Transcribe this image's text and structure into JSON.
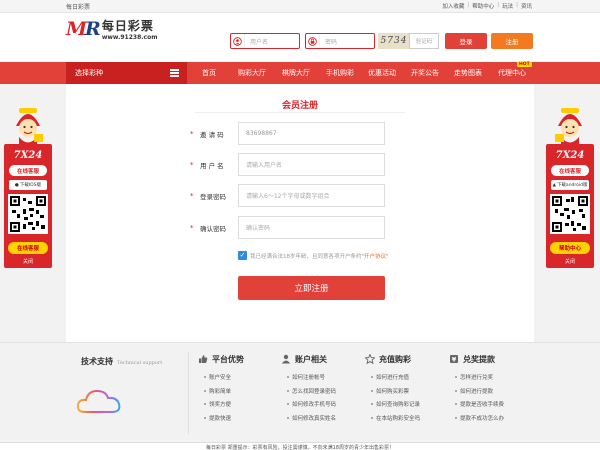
{
  "topbar": {
    "site_name": "每日彩票",
    "links": [
      "加入收藏",
      "帮助中心",
      "玩法",
      "资讯"
    ],
    "separator": "|"
  },
  "header": {
    "logo_mark_left": "M",
    "logo_mark_right": "R",
    "logo_name": "每日彩票",
    "logo_url": "www.91238.com",
    "username_placeholder": "用户名",
    "password_placeholder": "密码",
    "captcha_image_text": "5734",
    "captcha_placeholder": "验证码",
    "login_label": "登录",
    "register_label": "注册"
  },
  "nav": {
    "select_label": "选择彩种",
    "items": [
      "首页",
      "购彩大厅",
      "棋牌大厅",
      "手机购彩",
      "优惠活动",
      "开奖公告",
      "走势图表",
      "代理中心"
    ],
    "hot_tag": "HOT"
  },
  "form": {
    "title": "会员注册",
    "required_mark": "*",
    "rows": [
      {
        "label": "邀 请 码",
        "value": "83698867"
      },
      {
        "label": "用 户 名",
        "value": "请输入用户名"
      },
      {
        "label": "登录密码",
        "value": "请输入6～12个字母或数字组合"
      },
      {
        "label": "确认密码",
        "value": "确认密码"
      }
    ],
    "agree_text": "我已经满合法18岁年龄，且同意各项开户条约",
    "agree_protocol": "\"开户协议\"",
    "check_mark": "✓",
    "submit_label": "立即注册"
  },
  "float_widget": {
    "brand": "7X24",
    "service_label": "在线客服",
    "left_download": "下载IOS版",
    "right_download": "下载android版",
    "left_bottom_label": "在线客服",
    "right_bottom_label": "帮助中心",
    "close_label": "关闭"
  },
  "footer": {
    "tech_title": "技术支持",
    "tech_subtitle": "Technical support",
    "columns": [
      {
        "title": "平台优势",
        "icon": "thumbs-up-icon",
        "items": [
          "账户安全",
          "购彩简单",
          "领奖方便",
          "提款快速"
        ]
      },
      {
        "title": "账户相关",
        "icon": "user-icon",
        "items": [
          "如何注册帐号",
          "怎么找回登录密码",
          "如何修改手机号码",
          "如何修改真实姓名"
        ]
      },
      {
        "title": "充值购彩",
        "icon": "star-icon",
        "items": [
          "如何进行充值",
          "如何购买彩票",
          "如何查询购彩记录",
          "在本站购彩安全吗"
        ]
      },
      {
        "title": "兑奖提款",
        "icon": "money-icon",
        "items": [
          "怎样进行兑奖",
          "如何进行提款",
          "提款是否收手续费",
          "提款不成功怎么办"
        ]
      }
    ],
    "bottom_text": "每日彩票 郑重提示：彩票有风险，投注需谨慎，不向未满18周岁的青少年出售彩票！"
  },
  "colors": {
    "brand_red": "#e2413a",
    "dark_red": "#c8211f",
    "orange": "#f47a21",
    "link_blue": "#2d8be0",
    "hot_yellow": "#ffd800"
  }
}
